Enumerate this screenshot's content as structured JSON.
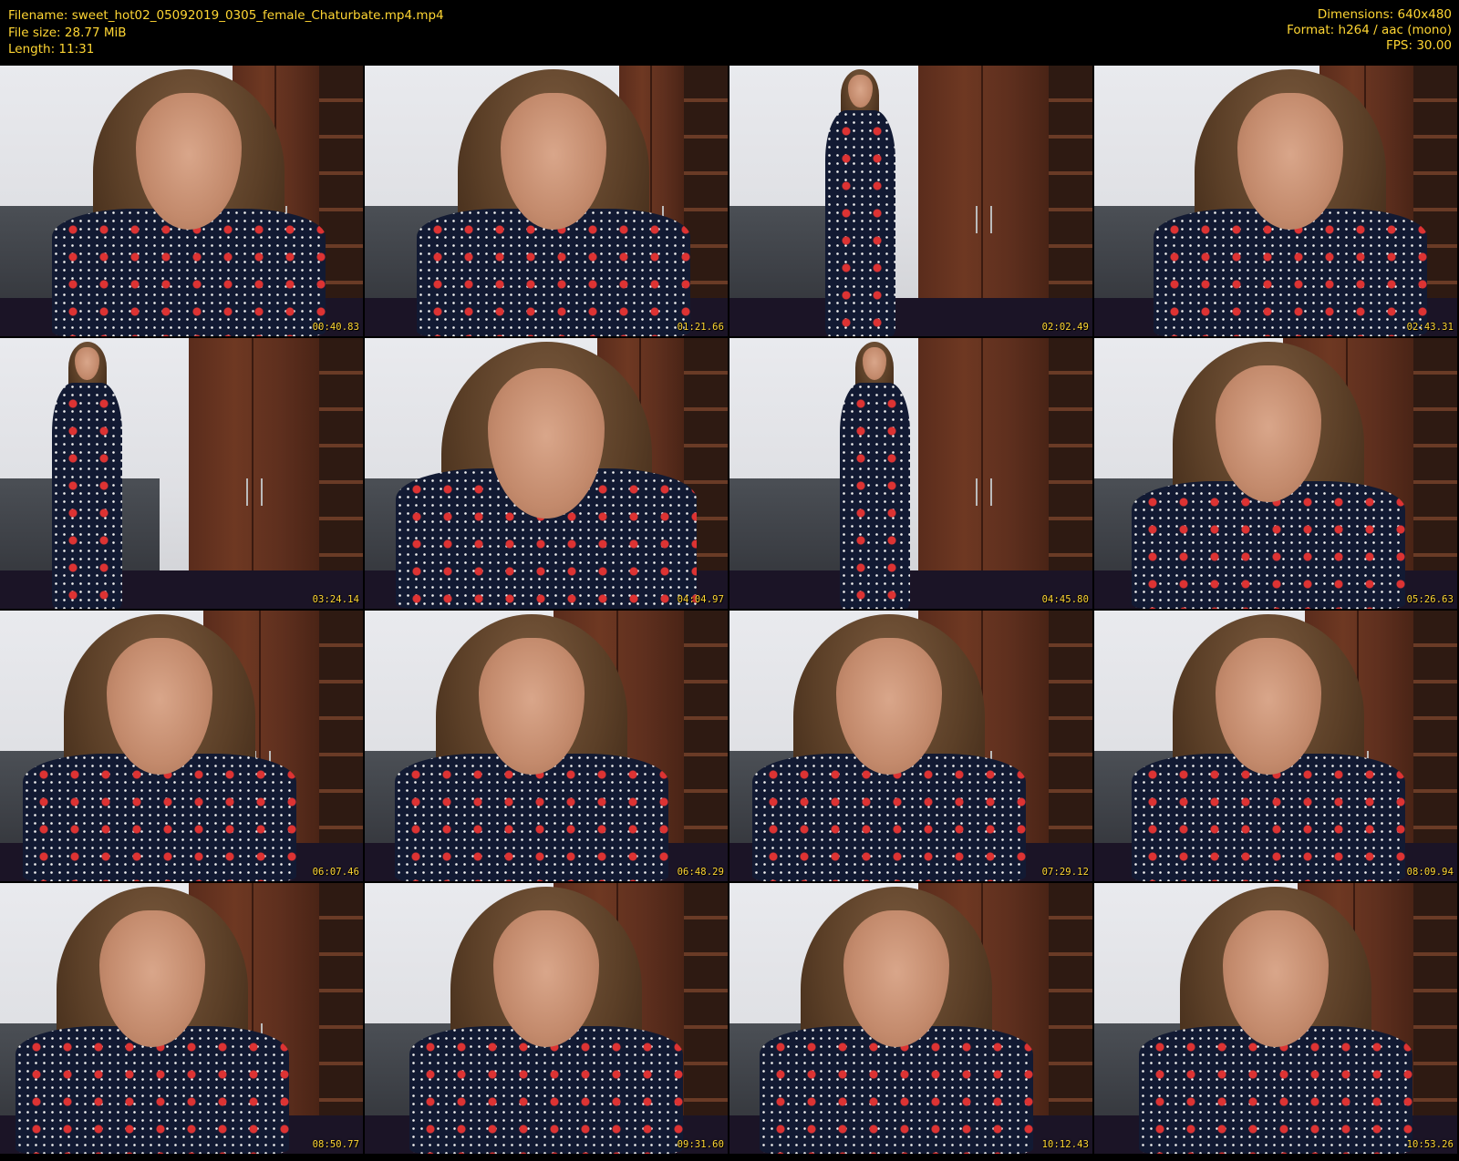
{
  "header": {
    "filename": "Filename: sweet_hot02_05092019_0305_female_Chaturbate.mp4.mp4",
    "filesize": "File size: 28.77 MiB",
    "length": "Length: 11:31",
    "dimensions": "Dimensions: 640x480",
    "format": "Format: h264 / aac (mono)",
    "fps": "FPS: 30.00"
  },
  "colors": {
    "text": "#ffd633",
    "background": "#000000"
  },
  "thumbnails": [
    {
      "timestamp": "00:40.83"
    },
    {
      "timestamp": "01:21.66"
    },
    {
      "timestamp": "02:02.49"
    },
    {
      "timestamp": "02:43.31"
    },
    {
      "timestamp": "03:24.14"
    },
    {
      "timestamp": "04:04.97"
    },
    {
      "timestamp": "04:45.80"
    },
    {
      "timestamp": "05:26.63"
    },
    {
      "timestamp": "06:07.46"
    },
    {
      "timestamp": "06:48.29"
    },
    {
      "timestamp": "07:29.12"
    },
    {
      "timestamp": "08:09.94"
    },
    {
      "timestamp": "08:50.77"
    },
    {
      "timestamp": "09:31.60"
    },
    {
      "timestamp": "10:12.43"
    },
    {
      "timestamp": "10:53.26"
    }
  ]
}
